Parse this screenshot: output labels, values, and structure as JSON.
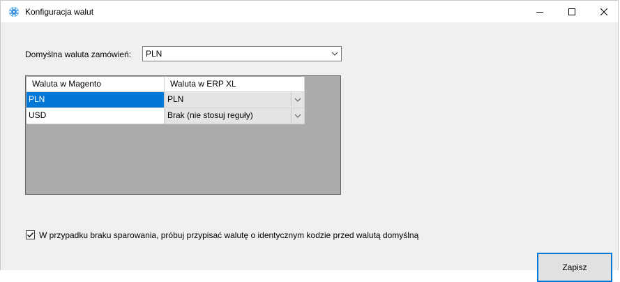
{
  "window": {
    "title": "Konfiguracja walut",
    "icon": "gear-icon",
    "controls": {
      "minimize": "minimize-icon",
      "maximize": "maximize-icon",
      "close": "close-icon"
    }
  },
  "default_currency": {
    "label": "Domyślna waluta zamówień:",
    "value": "PLN"
  },
  "mapping_grid": {
    "columns": [
      "Waluta w Magento",
      "Waluta w ERP XL"
    ],
    "rows": [
      {
        "magento": "PLN",
        "erp": "PLN",
        "selected": true
      },
      {
        "magento": "USD",
        "erp": "Brak (nie stosuj reguły)",
        "selected": false
      }
    ]
  },
  "fallback_option": {
    "checked": true,
    "label": "W przypadku braku sparowania, próbuj przypisać walutę o identycznym kodzie przed walutą domyślną"
  },
  "actions": {
    "save_label": "Zapisz"
  },
  "colors": {
    "accent": "#0078d7",
    "grid_background": "#ababab",
    "window_background": "#f0f0f0"
  }
}
